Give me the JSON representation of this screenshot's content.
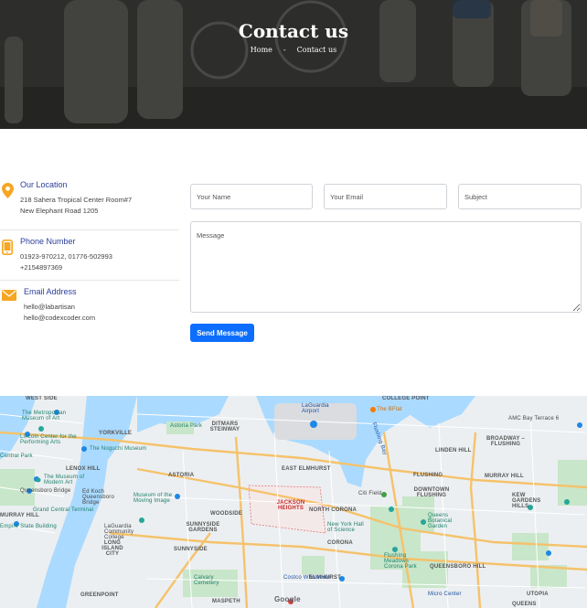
{
  "hero": {
    "title": "Contact us",
    "breadcrumb": {
      "home": "Home",
      "separator": "-",
      "current": "Contact us"
    }
  },
  "contact_info": [
    {
      "title": "Our Location",
      "icon": "location-pin-icon",
      "lines": [
        "218 Sahera Tropical Center Room#7",
        "New Elephant Road 1205"
      ]
    },
    {
      "title": "Phone Number",
      "icon": "phone-icon",
      "lines": [
        "01923-970212, 01776-502993",
        "+2154897369"
      ]
    },
    {
      "title": "Email Address",
      "icon": "envelope-icon",
      "lines": [
        "hello@labartisan",
        "hello@codexcoder.com"
      ]
    }
  ],
  "form": {
    "name_placeholder": "Your Name",
    "email_placeholder": "Your Email",
    "subject_placeholder": "Subject",
    "message_placeholder": "Message",
    "send_label": "Send Message"
  },
  "colors": {
    "accent": "#0d6efd",
    "info_title": "#2c3e9a",
    "icon": "#f5a623"
  },
  "map": {
    "labels": {
      "west_side": "WEST SIDE",
      "met_museum": "The Metropolitan Museum of Art",
      "lincoln_center": "Lincoln Center for the Performing Arts",
      "central_park": "Central Park",
      "yorkville": "YORKVILLE",
      "noguchi": "The Noguchi Museum",
      "lenox_hill": "LENOX HILL",
      "moma": "The Museum of Modern Art",
      "ed_koch": "Ed Koch Queensboro Bridge",
      "astoria_park": "Astoria Park",
      "ditmars": "DITMARS STEINWAY",
      "astoria": "ASTORIA",
      "laguardia": "LaGuardia Airport",
      "east_elmhurst": "EAST ELMHURST",
      "college_point": "COLLEGE POINT",
      "the_bflat": "The BFlat",
      "flushing_bay": "Flushing Bay",
      "amc_bay": "AMC Bay Terrace 6",
      "broadway_flushing": "BROADWAY –FLUSHING",
      "linden_hill": "LINDEN HILL",
      "murray_hill_q": "MURRAY HILL",
      "flushing": "FLUSHING",
      "downtown_flushing": "DOWNTOWN FLUSHING",
      "citi_field": "Citi Field",
      "jackson_heights": "JACKSON HEIGHTS",
      "north_corona": "NORTH CORONA",
      "museum_moving_image": "Museum of the Moving Image",
      "woodside": "WOODSIDE",
      "sunnyside_gardens": "SUNNYSIDE GARDENS",
      "sunnyside": "SUNNYSIDE",
      "new_york_hall": "New York Hall of Science",
      "corona": "CORONA",
      "queens_botanical": "Queens Botanical Garden",
      "kew_gardens_hills": "KEW GARDENS HILLS",
      "queensboro_bridge_l": "Queensboro Bridge",
      "grand_central": "Grand Central Terminal",
      "murray_hill": "MURRAY HILL",
      "empire_state": "Empire State Building",
      "long_island_city": "LONG ISLAND CITY",
      "laguardia_cc": "LaGuardia Community College",
      "elmhurst": "ELMHURST",
      "flushing_meadows": "Flushing Meadows Corona Park",
      "costco": "Costco Wholesale",
      "calvary": "Calvary Cemetery",
      "queensboro_hill": "QUEENSBORO HILL",
      "greenpoint": "GREENPOINT",
      "maspeth": "MASPETH",
      "micro_center": "Micro Center",
      "utopia": "UTOPIA",
      "queens": "QUEENS",
      "google": "Google"
    }
  }
}
